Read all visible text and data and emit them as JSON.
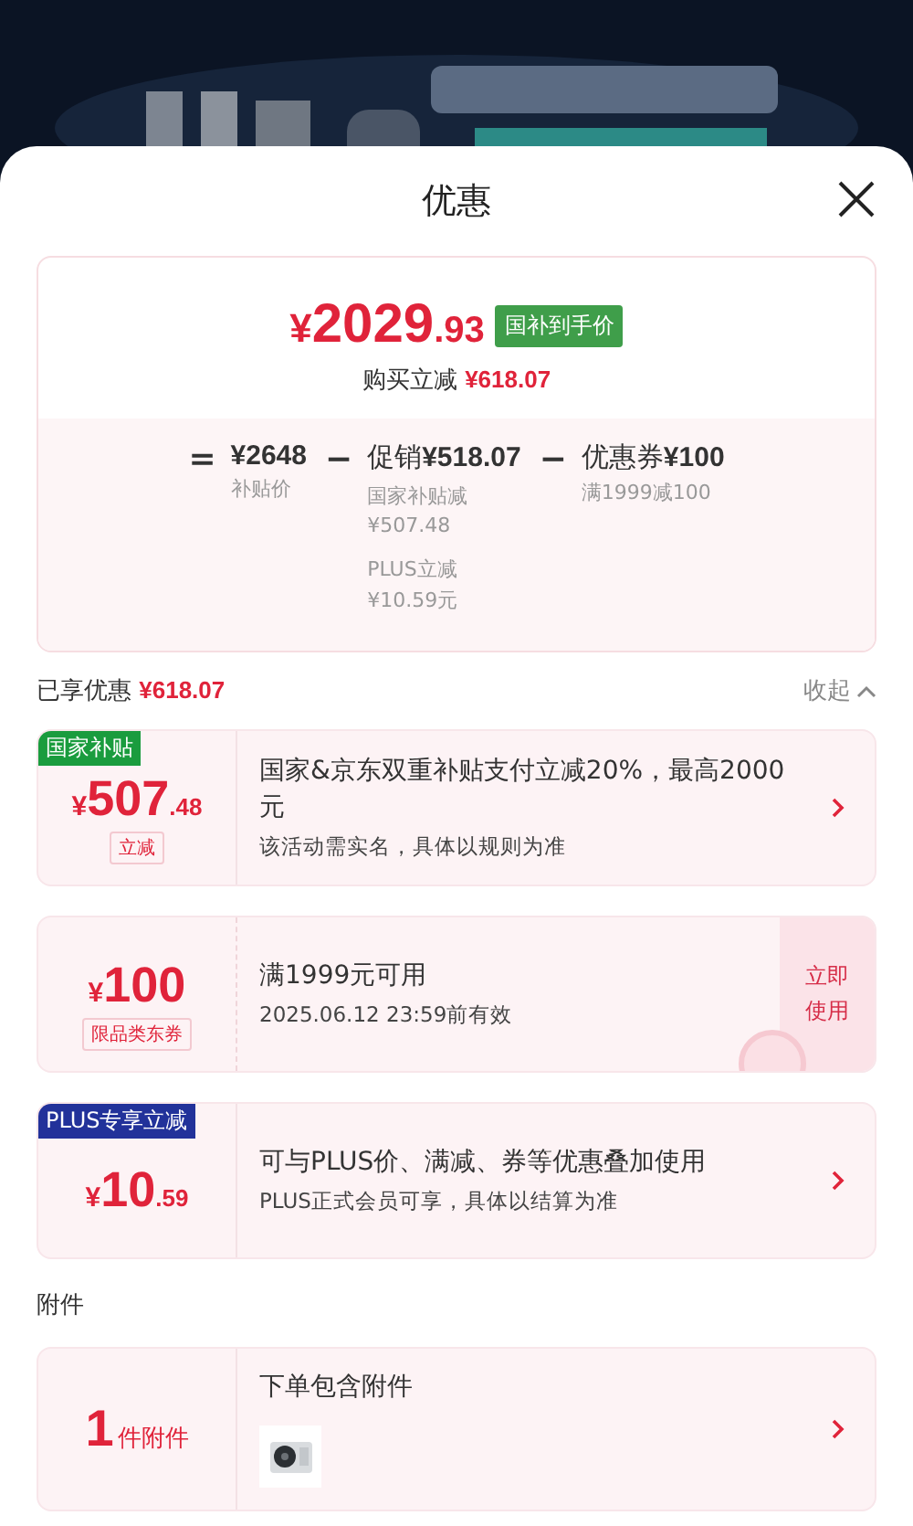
{
  "sheet": {
    "title": "优惠"
  },
  "summary": {
    "price": {
      "currency": "¥",
      "integer": "2029",
      "decimal": ".93"
    },
    "badge": "国补到手价",
    "saving_label": "购买立减",
    "saving_value": "¥618.07",
    "formula": [
      {
        "operator": "=",
        "value": "¥2648",
        "caption": "补贴价"
      },
      {
        "operator": "−",
        "prefix": "促销",
        "value": "¥518.07",
        "details": [
          {
            "label": "国家补贴减",
            "amount": "¥507.48"
          },
          {
            "label": "PLUS立减",
            "amount": "¥10.59元"
          }
        ]
      },
      {
        "operator": "−",
        "prefix": "优惠券",
        "value": "¥100",
        "caption": "满1999减100"
      }
    ]
  },
  "enjoyed": {
    "label": "已享优惠",
    "value": "¥618.07",
    "toggle": "收起",
    "expanded": true
  },
  "offers": [
    {
      "kind": "subsidy",
      "tag": {
        "text": "国家补贴",
        "color": "#1a9c3e"
      },
      "amount": {
        "currency": "¥",
        "integer": "507",
        "decimal": ".48"
      },
      "note": "立减",
      "title": "国家&京东双重补贴支付立减20%，最高2000元",
      "subtitle": "该活动需实名，具体以规则为准"
    },
    {
      "kind": "coupon",
      "amount": {
        "currency": "¥",
        "integer": "100"
      },
      "note": "限品类东券",
      "title": "满1999元可用",
      "subtitle": "2025.06.12 23:59前有效",
      "action": "立即使用",
      "claimed": true
    },
    {
      "kind": "plus",
      "tag": {
        "text": "PLUS专享立减",
        "color": "#22329a"
      },
      "amount": {
        "currency": "¥",
        "integer": "10",
        "decimal": ".59"
      },
      "title": "可与PLUS价、满减、券等优惠叠加使用",
      "subtitle": "PLUS正式会员可享，具体以结算为准"
    }
  ],
  "accessories": {
    "heading": "附件",
    "count": "1",
    "unit": "件附件",
    "title": "下单包含附件"
  }
}
